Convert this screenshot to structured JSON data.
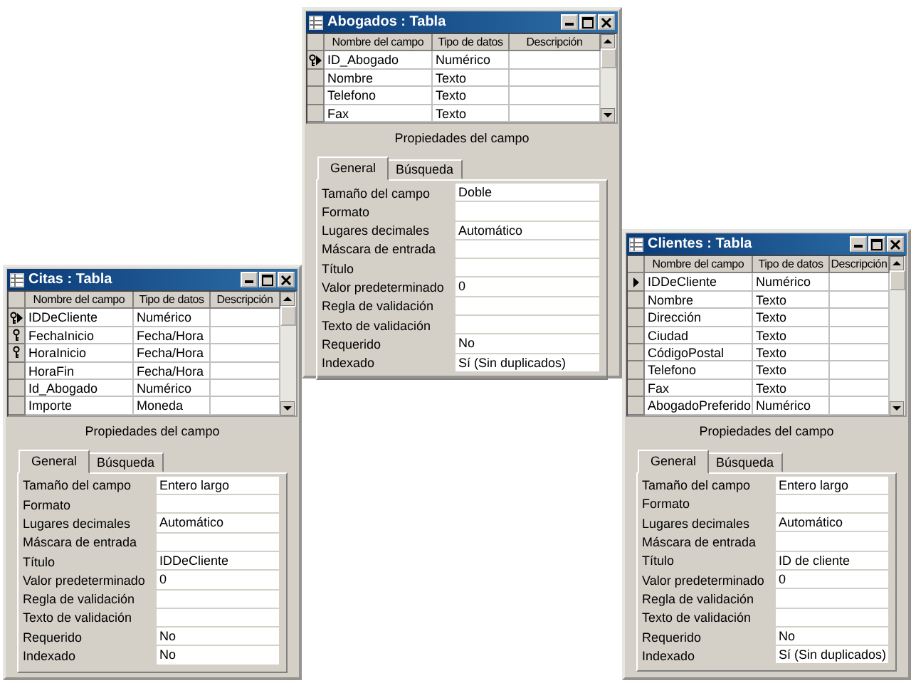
{
  "windows": [
    {
      "title": "Abogados : Tabla",
      "columns": [
        "Nombre del campo",
        "Tipo de datos",
        "Descripción"
      ],
      "fields": [
        {
          "name": "ID_Abogado",
          "type": "Numérico",
          "primary_key": true,
          "current": true
        },
        {
          "name": "Nombre",
          "type": "Texto",
          "primary_key": false,
          "current": false
        },
        {
          "name": "Telefono",
          "type": "Texto",
          "primary_key": false,
          "current": false
        },
        {
          "name": "Fax",
          "type": "Texto",
          "primary_key": false,
          "current": false
        }
      ],
      "properties_heading": "Propiedades del campo",
      "tabs": [
        {
          "label": "General",
          "selected": true
        },
        {
          "label": "Búsqueda",
          "selected": false
        }
      ],
      "properties": [
        {
          "label": "Tamaño del campo",
          "value": "Doble"
        },
        {
          "label": "Formato"
        },
        {
          "label": "Lugares decimales",
          "value": "Automático"
        },
        {
          "label": "Máscara de entrada"
        },
        {
          "label": "Título"
        },
        {
          "label": "Valor predeterminado",
          "value": "0"
        },
        {
          "label": "Regla de validación"
        },
        {
          "label": "Texto de validación"
        },
        {
          "label": "Requerido",
          "value": "No"
        },
        {
          "label": "Indexado",
          "value": "Sí (Sin duplicados)"
        }
      ]
    },
    {
      "title": "Citas : Tabla",
      "columns": [
        "Nombre del campo",
        "Tipo de datos",
        "Descripción"
      ],
      "fields": [
        {
          "name": "IDDeCliente",
          "type": "Numérico",
          "primary_key": true,
          "current": true
        },
        {
          "name": "FechaInicio",
          "type": "Fecha/Hora",
          "primary_key": true,
          "current": false
        },
        {
          "name": "HoraInicio",
          "type": "Fecha/Hora",
          "primary_key": true,
          "current": false
        },
        {
          "name": "HoraFin",
          "type": "Fecha/Hora",
          "primary_key": false,
          "current": false
        },
        {
          "name": "Id_Abogado",
          "type": "Numérico",
          "primary_key": false,
          "current": false
        },
        {
          "name": "Importe",
          "type": "Moneda",
          "primary_key": false,
          "current": false
        }
      ],
      "properties_heading": "Propiedades del campo",
      "tabs": [
        {
          "label": "General",
          "selected": true
        },
        {
          "label": "Búsqueda",
          "selected": false
        }
      ],
      "properties": [
        {
          "label": "Tamaño del campo",
          "value": "Entero largo"
        },
        {
          "label": "Formato"
        },
        {
          "label": "Lugares decimales",
          "value": "Automático"
        },
        {
          "label": "Máscara de entrada"
        },
        {
          "label": "Título",
          "value": "IDDeCliente"
        },
        {
          "label": "Valor predeterminado",
          "value": "0"
        },
        {
          "label": "Regla de validación"
        },
        {
          "label": "Texto de validación"
        },
        {
          "label": "Requerido",
          "value": "No"
        },
        {
          "label": "Indexado",
          "value": "No"
        }
      ]
    },
    {
      "title": "Clientes : Tabla",
      "columns": [
        "Nombre del campo",
        "Tipo de datos",
        "Descripción"
      ],
      "fields": [
        {
          "name": "IDDeCliente",
          "type": "Numérico",
          "primary_key": false,
          "current": true
        },
        {
          "name": "Nombre",
          "type": "Texto",
          "primary_key": false,
          "current": false
        },
        {
          "name": "Dirección",
          "type": "Texto",
          "primary_key": false,
          "current": false
        },
        {
          "name": "Ciudad",
          "type": "Texto",
          "primary_key": false,
          "current": false
        },
        {
          "name": "CódigoPostal",
          "type": "Texto",
          "primary_key": false,
          "current": false
        },
        {
          "name": "Telefono",
          "type": "Texto",
          "primary_key": false,
          "current": false
        },
        {
          "name": "Fax",
          "type": "Texto",
          "primary_key": false,
          "current": false
        },
        {
          "name": "AbogadoPreferido",
          "type": "Numérico",
          "primary_key": false,
          "current": false
        }
      ],
      "properties_heading": "Propiedades del campo",
      "tabs": [
        {
          "label": "General",
          "selected": true
        },
        {
          "label": "Búsqueda",
          "selected": false
        }
      ],
      "properties": [
        {
          "label": "Tamaño del campo",
          "value": "Entero largo"
        },
        {
          "label": "Formato"
        },
        {
          "label": "Lugares decimales",
          "value": "Automático"
        },
        {
          "label": "Máscara de entrada"
        },
        {
          "label": "Título",
          "value": "ID de cliente"
        },
        {
          "label": "Valor predeterminado",
          "value": "0"
        },
        {
          "label": "Regla de validación"
        },
        {
          "label": "Texto de validación"
        },
        {
          "label": "Requerido",
          "value": "No"
        },
        {
          "label": "Indexado",
          "value": "Sí (Sin duplicados)"
        }
      ]
    }
  ]
}
